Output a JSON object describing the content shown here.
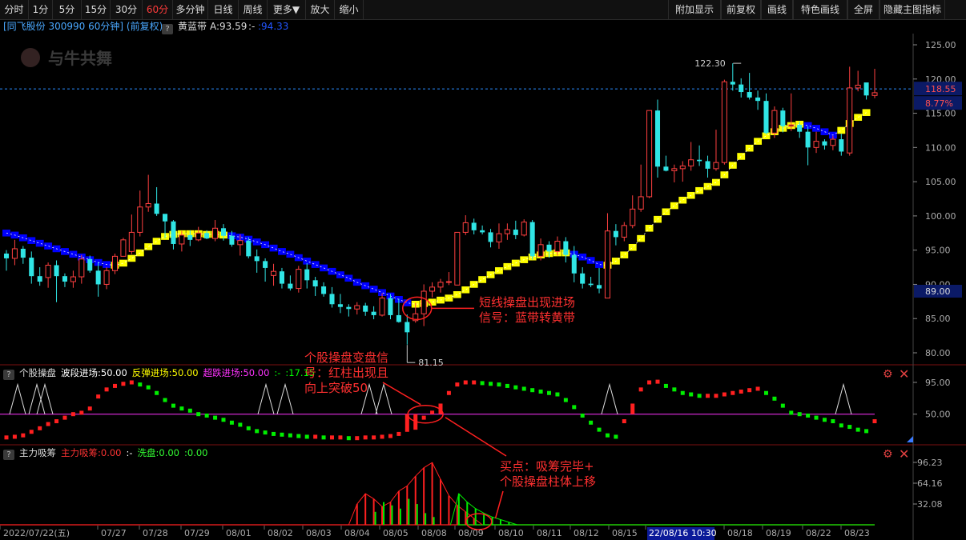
{
  "toolbar": {
    "left": [
      "分时",
      "1分",
      "5分",
      "15分",
      "30分",
      "60分",
      "多分钟",
      "日线",
      "周线",
      "更多▼",
      "放大",
      "缩小"
    ],
    "active": "60分",
    "right": [
      "附加显示",
      "前复权",
      "画线",
      "特色画线",
      "全屏",
      "隐藏主图指标"
    ]
  },
  "info": {
    "stock": "[同飞股份 300990 60分钟] (前复权)",
    "indicator": "黄蓝带",
    "value_a": "A:93.59",
    "value_b": ":-",
    "value_c": ":94.33",
    "watermark": "与牛共舞"
  },
  "main_axis": {
    "ticks": [
      "125.00",
      "120.00",
      "115.00",
      "110.00",
      "105.00",
      "100.00",
      "95.00",
      "90.00",
      "85.00",
      "80.00"
    ],
    "price_tag": "118.55",
    "pct_tag": "8.77%",
    "low_tag": "89.00",
    "high_label": "122.30",
    "low_label": "81.15"
  },
  "panel2": {
    "name": "个股操盘",
    "items": [
      {
        "text": "波段进场:50.00",
        "color": "#ffffff"
      },
      {
        "text": "反弹进场:50.00",
        "color": "#ffff00"
      },
      {
        "text": "超跌进场:50.00",
        "color": "#ff33ff"
      },
      {
        "text": ":-",
        "color": "#00ff00"
      },
      {
        "text": ":17.15",
        "color": "#00ff00"
      }
    ],
    "ticks": [
      "95.00",
      "50.00"
    ]
  },
  "panel3": {
    "name": "主力吸筹",
    "items": [
      {
        "text": "主力吸筹:0.00",
        "color": "#ff3333"
      },
      {
        "text": ":-",
        "color": "#ffffff"
      },
      {
        "text": "洗盘:0.00",
        "color": "#33ff33"
      },
      {
        "text": ":0.00",
        "color": "#33ff33"
      }
    ],
    "ticks": [
      "96.23",
      "64.16",
      "32.08"
    ]
  },
  "dates": [
    "2022/07/22(五)",
    "07/27",
    "07/28",
    "07/29",
    "08/01",
    "08/02",
    "08/03",
    "08/04",
    "08/05",
    "08/08",
    "08/09",
    "08/10",
    "08/11",
    "08/12",
    "08/15",
    "22/08/16 10:30",
    "08/18",
    "08/19",
    "08/22",
    "08/23"
  ],
  "annotations": {
    "a1": "短线操盘出现进场\n信号：蓝带转黄带",
    "a2": "个股操盘变盘信\n号：红柱出现且\n向上突破50",
    "a3": "买点：吸筹完毕+\n个股操盘柱体上移"
  },
  "chart_data": {
    "type": "candlestick",
    "y_axis": {
      "min": 80,
      "max": 125,
      "ticks": [
        125,
        120,
        115,
        110,
        105,
        100,
        95,
        90,
        85,
        80
      ]
    },
    "current_price": 118.55,
    "change_pct": "8.77%",
    "high_marker": 122.3,
    "low_marker": 81.15,
    "candles": [
      [
        94.5,
        95.0,
        92.0,
        93.8
      ],
      [
        93.8,
        96.5,
        92.8,
        95.2
      ],
      [
        95.2,
        95.6,
        93.0,
        93.9
      ],
      [
        93.9,
        94.8,
        90.1,
        91.2
      ],
      [
        91.2,
        92.5,
        89.8,
        90.4
      ],
      [
        91.0,
        93.2,
        89.5,
        92.8
      ],
      [
        92.8,
        93.5,
        87.4,
        91.2
      ],
      [
        91.2,
        91.6,
        89.6,
        90.4
      ],
      [
        90.4,
        92.0,
        89.5,
        91.1
      ],
      [
        91.1,
        94.3,
        90.1,
        93.7
      ],
      [
        93.7,
        94.2,
        91.7,
        92.0
      ],
      [
        92.0,
        93.2,
        88.2,
        90.0
      ],
      [
        90.0,
        92.5,
        89.3,
        92.0
      ],
      [
        92.0,
        94.5,
        91.5,
        94.1
      ],
      [
        94.1,
        96.8,
        94.5,
        96.5
      ],
      [
        94.8,
        100.2,
        94.4,
        97.6
      ],
      [
        97.6,
        103.7,
        97.0,
        101.3
      ],
      [
        101.3,
        106.0,
        100.6,
        101.8
      ],
      [
        101.8,
        104.2,
        100.0,
        100.3
      ],
      [
        100.3,
        100.2,
        96.7,
        99.2
      ],
      [
        99.2,
        99.4,
        95.1,
        95.9
      ],
      [
        95.9,
        97.8,
        94.8,
        97.2
      ],
      [
        97.2,
        97.9,
        95.6,
        96.5
      ],
      [
        96.5,
        98.4,
        96.3,
        97.5
      ],
      [
        97.5,
        97.9,
        96.6,
        96.7
      ],
      [
        96.7,
        99.4,
        96.3,
        98.2
      ],
      [
        98.2,
        98.8,
        96.4,
        97.1
      ],
      [
        97.1,
        97.8,
        95.5,
        95.8
      ],
      [
        95.8,
        97.3,
        94.2,
        96.4
      ],
      [
        96.4,
        96.9,
        93.8,
        94.1
      ],
      [
        94.1,
        95.1,
        91.7,
        93.4
      ],
      [
        93.4,
        93.8,
        90.4,
        92.4
      ],
      [
        91.3,
        93.0,
        89.8,
        91.9
      ],
      [
        91.9,
        92.4,
        89.4,
        90.1
      ],
      [
        90.1,
        91.3,
        89.1,
        89.4
      ],
      [
        89.4,
        92.7,
        88.8,
        92.2
      ],
      [
        92.2,
        93.1,
        89.4,
        90.6
      ],
      [
        90.6,
        91.1,
        88.3,
        89.7
      ],
      [
        89.7,
        90.3,
        88.2,
        88.6
      ],
      [
        88.6,
        89.6,
        86.6,
        87.1
      ],
      [
        87.1,
        88.6,
        85.8,
        86.7
      ],
      [
        86.7,
        87.1,
        85.3,
        86.4
      ],
      [
        86.4,
        87.4,
        85.6,
        86.9
      ],
      [
        86.9,
        87.3,
        85.4,
        86.0
      ],
      [
        86.0,
        86.8,
        84.9,
        85.5
      ],
      [
        85.5,
        88.7,
        85.3,
        88.0
      ],
      [
        88.0,
        88.6,
        84.9,
        85.5
      ],
      [
        85.5,
        87.9,
        84.4,
        84.5
      ],
      [
        84.5,
        85.6,
        81.2,
        83.0
      ],
      [
        84.7,
        87.3,
        84.4,
        85.7
      ],
      [
        85.7,
        90.0,
        83.9,
        89.0
      ],
      [
        89.0,
        90.3,
        88.1,
        89.6
      ],
      [
        89.6,
        90.8,
        88.8,
        90.3
      ],
      [
        90.3,
        91.8,
        89.9,
        90.4
      ],
      [
        89.9,
        97.6,
        89.9,
        97.6
      ],
      [
        97.6,
        100.1,
        97.2,
        99.0
      ],
      [
        99.0,
        99.6,
        97.3,
        97.9
      ],
      [
        97.9,
        98.6,
        97.3,
        97.6
      ],
      [
        97.6,
        98.1,
        95.4,
        96.2
      ],
      [
        96.2,
        98.9,
        95.2,
        97.4
      ],
      [
        97.4,
        98.9,
        96.5,
        98.0
      ],
      [
        98.0,
        99.3,
        96.6,
        97.2
      ],
      [
        97.2,
        99.5,
        97.0,
        99.1
      ],
      [
        99.1,
        99.4,
        93.6,
        94.1
      ],
      [
        94.1,
        96.7,
        93.5,
        95.8
      ],
      [
        95.8,
        96.3,
        93.9,
        94.8
      ],
      [
        94.8,
        97.0,
        94.2,
        96.3
      ],
      [
        96.3,
        96.9,
        93.2,
        94.3
      ],
      [
        94.3,
        95.6,
        90.3,
        91.6
      ],
      [
        91.6,
        92.5,
        89.4,
        90.1
      ],
      [
        90.1,
        91.1,
        89.6,
        89.9
      ],
      [
        89.9,
        92.4,
        88.7,
        89.4
      ],
      [
        88.0,
        100.4,
        88.0,
        97.8
      ],
      [
        97.8,
        98.8,
        95.7,
        96.9
      ],
      [
        96.9,
        99.1,
        96.3,
        98.6
      ],
      [
        98.6,
        103.0,
        98.2,
        101.0
      ],
      [
        101.0,
        107.5,
        100.6,
        102.8
      ],
      [
        102.8,
        115.0,
        102.6,
        115.4
      ],
      [
        115.4,
        117.0,
        105.6,
        107.2
      ],
      [
        107.2,
        108.8,
        106.5,
        106.6
      ],
      [
        106.6,
        107.5,
        104.9,
        106.9
      ],
      [
        106.9,
        108.0,
        105.0,
        107.3
      ],
      [
        107.3,
        110.8,
        106.6,
        108.2
      ],
      [
        108.2,
        110.3,
        107.3,
        108.0
      ],
      [
        108.0,
        108.8,
        105.6,
        106.9
      ],
      [
        106.9,
        112.6,
        106.6,
        107.8
      ],
      [
        107.8,
        119.9,
        107.5,
        119.6
      ],
      [
        119.6,
        122.3,
        118.3,
        119.2
      ],
      [
        119.2,
        120.1,
        117.3,
        118.1
      ],
      [
        118.1,
        120.9,
        117.0,
        117.3
      ],
      [
        117.3,
        118.3,
        115.5,
        116.8
      ],
      [
        116.8,
        117.9,
        111.9,
        112.1
      ],
      [
        112.1,
        116.0,
        111.4,
        115.4
      ],
      [
        115.4,
        115.8,
        112.2,
        113.1
      ],
      [
        113.1,
        117.9,
        112.4,
        113.3
      ],
      [
        113.3,
        113.8,
        111.4,
        112.3
      ],
      [
        112.3,
        113.1,
        107.4,
        110.0
      ],
      [
        110.0,
        112.3,
        109.2,
        110.9
      ],
      [
        110.9,
        111.2,
        109.7,
        110.3
      ],
      [
        110.3,
        111.7,
        109.6,
        111.2
      ],
      [
        111.2,
        112.0,
        108.8,
        109.4
      ],
      [
        109.2,
        121.8,
        108.8,
        118.7
      ],
      [
        118.7,
        121.2,
        118.2,
        119.1
      ],
      [
        119.5,
        119.3,
        117.0,
        117.6
      ],
      [
        117.6,
        121.5,
        117.2,
        118.0
      ]
    ],
    "band": [
      [
        97.5,
        "b"
      ],
      [
        97.2,
        "b"
      ],
      [
        96.8,
        "b"
      ],
      [
        96.4,
        "b"
      ],
      [
        96.0,
        "b"
      ],
      [
        95.6,
        "b"
      ],
      [
        95.2,
        "b"
      ],
      [
        94.8,
        "b"
      ],
      [
        94.4,
        "b"
      ],
      [
        94.0,
        "b"
      ],
      [
        93.6,
        "b"
      ],
      [
        93.2,
        "b"
      ],
      [
        92.9,
        "b"
      ],
      [
        92.8,
        "y"
      ],
      [
        93.1,
        "y"
      ],
      [
        93.8,
        "y"
      ],
      [
        94.6,
        "y"
      ],
      [
        95.5,
        "y"
      ],
      [
        96.3,
        "y"
      ],
      [
        97.0,
        "y"
      ],
      [
        97.3,
        "y"
      ],
      [
        97.4,
        "y"
      ],
      [
        97.4,
        "y"
      ],
      [
        97.4,
        "y"
      ],
      [
        97.3,
        "y"
      ],
      [
        97.3,
        "y"
      ],
      [
        97.2,
        "y"
      ],
      [
        97.1,
        "b"
      ],
      [
        96.9,
        "b"
      ],
      [
        96.6,
        "b"
      ],
      [
        96.2,
        "b"
      ],
      [
        95.8,
        "b"
      ],
      [
        95.3,
        "b"
      ],
      [
        94.8,
        "b"
      ],
      [
        94.4,
        "b"
      ],
      [
        93.9,
        "b"
      ],
      [
        93.4,
        "b"
      ],
      [
        92.9,
        "b"
      ],
      [
        92.4,
        "b"
      ],
      [
        91.9,
        "b"
      ],
      [
        91.4,
        "b"
      ],
      [
        90.9,
        "b"
      ],
      [
        90.3,
        "b"
      ],
      [
        89.8,
        "b"
      ],
      [
        89.3,
        "b"
      ],
      [
        88.8,
        "b"
      ],
      [
        88.3,
        "b"
      ],
      [
        87.8,
        "b"
      ],
      [
        87.3,
        "b"
      ],
      [
        87.1,
        "y"
      ],
      [
        87.2,
        "y"
      ],
      [
        87.4,
        "y"
      ],
      [
        87.7,
        "y"
      ],
      [
        88.0,
        "y"
      ],
      [
        88.5,
        "y"
      ],
      [
        89.2,
        "y"
      ],
      [
        90.0,
        "y"
      ],
      [
        90.7,
        "y"
      ],
      [
        91.4,
        "y"
      ],
      [
        92.0,
        "y"
      ],
      [
        92.6,
        "y"
      ],
      [
        93.1,
        "y"
      ],
      [
        93.6,
        "y"
      ],
      [
        94.0,
        "y"
      ],
      [
        94.3,
        "y"
      ],
      [
        94.5,
        "y"
      ],
      [
        94.6,
        "y"
      ],
      [
        94.6,
        "y"
      ],
      [
        94.4,
        "b"
      ],
      [
        94.0,
        "b"
      ],
      [
        93.5,
        "b"
      ],
      [
        92.9,
        "b"
      ],
      [
        92.8,
        "y"
      ],
      [
        93.4,
        "y"
      ],
      [
        94.3,
        "y"
      ],
      [
        95.4,
        "y"
      ],
      [
        96.7,
        "y"
      ],
      [
        98.2,
        "y"
      ],
      [
        99.5,
        "y"
      ],
      [
        100.6,
        "y"
      ],
      [
        101.5,
        "y"
      ],
      [
        102.3,
        "y"
      ],
      [
        103.0,
        "y"
      ],
      [
        103.7,
        "y"
      ],
      [
        104.3,
        "y"
      ],
      [
        104.9,
        "y"
      ],
      [
        106.0,
        "y"
      ],
      [
        107.4,
        "y"
      ],
      [
        108.7,
        "y"
      ],
      [
        109.9,
        "y"
      ],
      [
        110.9,
        "y"
      ],
      [
        111.7,
        "y"
      ],
      [
        112.3,
        "y"
      ],
      [
        112.8,
        "y"
      ],
      [
        113.2,
        "y"
      ],
      [
        113.4,
        "y"
      ],
      [
        113.2,
        "b"
      ],
      [
        112.8,
        "b"
      ],
      [
        112.3,
        "b"
      ],
      [
        111.8,
        "b"
      ],
      [
        112.5,
        "y"
      ],
      [
        113.5,
        "y"
      ],
      [
        114.4,
        "y"
      ],
      [
        115.1,
        "y"
      ]
    ],
    "panel2_values": [
      17,
      18,
      20,
      25,
      30,
      36,
      40,
      45,
      50,
      52,
      58,
      75,
      85,
      90,
      93,
      95,
      92,
      88,
      80,
      70,
      62,
      58,
      55,
      50,
      48,
      45,
      42,
      38,
      35,
      30,
      26,
      24,
      22,
      21,
      20,
      19,
      18,
      18,
      17,
      17,
      17,
      16,
      16,
      17,
      17,
      18,
      19,
      22,
      25,
      28,
      45,
      55,
      65,
      80,
      92,
      95,
      95,
      94,
      93,
      92,
      90,
      88,
      86,
      84,
      82,
      80,
      78,
      70,
      60,
      48,
      38,
      28,
      20,
      18,
      40,
      65,
      85,
      95,
      96,
      90,
      85,
      80,
      78,
      76,
      76,
      76,
      78,
      80,
      82,
      84,
      86,
      80,
      72,
      62,
      52,
      50,
      48,
      45,
      42,
      40,
      34,
      32,
      28,
      26,
      40,
      60,
      82,
      82
    ],
    "panel3_red": [
      0,
      0,
      0,
      0,
      0,
      0,
      0,
      0,
      0,
      0,
      0,
      0,
      0,
      0,
      0,
      0,
      0,
      0,
      0,
      0,
      0,
      0,
      0,
      0,
      0,
      0,
      0,
      0,
      0,
      0,
      0,
      0,
      0,
      0,
      0,
      0,
      0,
      0,
      0,
      0,
      0,
      0,
      32,
      48,
      40,
      28,
      35,
      52,
      60,
      75,
      88,
      96,
      70,
      45,
      30,
      20,
      10,
      0,
      0,
      0,
      0,
      0,
      0,
      0,
      0,
      0,
      0,
      0,
      0,
      0,
      0,
      0,
      0,
      0,
      0,
      0,
      0,
      0,
      0,
      0,
      0,
      0,
      0,
      0,
      0,
      0,
      0,
      0,
      0,
      0,
      0,
      0,
      0,
      0,
      0,
      0,
      0,
      0,
      0,
      0,
      0,
      0,
      0,
      0,
      0,
      0,
      0,
      0
    ],
    "panel3_green": [
      0,
      0,
      0,
      0,
      0,
      0,
      0,
      0,
      0,
      0,
      0,
      0,
      0,
      0,
      0,
      0,
      0,
      0,
      0,
      0,
      0,
      0,
      0,
      0,
      0,
      0,
      0,
      0,
      0,
      0,
      0,
      0,
      0,
      0,
      0,
      0,
      0,
      0,
      0,
      0,
      0,
      0,
      0,
      0,
      20,
      35,
      30,
      25,
      40,
      32,
      18,
      12,
      0,
      0,
      48,
      35,
      25,
      18,
      12,
      8,
      4,
      0,
      0,
      0,
      0,
      0,
      0,
      0,
      0,
      0,
      0,
      0,
      0,
      0,
      0,
      0,
      0,
      0,
      0,
      0,
      0,
      0,
      0,
      0,
      0,
      0,
      0,
      0,
      0,
      0,
      0,
      0,
      0,
      0,
      0,
      0,
      0,
      0,
      0,
      0,
      0,
      0,
      0,
      0,
      0,
      0,
      0,
      0
    ]
  }
}
